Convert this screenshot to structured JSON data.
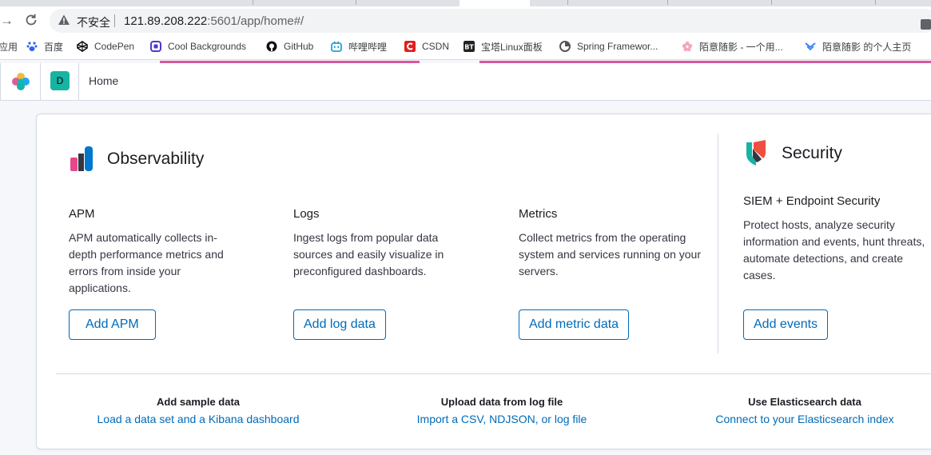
{
  "browser": {
    "security_label": "不安全",
    "url_host": "121.89.208.222",
    "url_rest": ":5601/app/home#/"
  },
  "bookmarks": [
    {
      "label": "应用",
      "icon": "apps-icon"
    },
    {
      "label": "百度",
      "icon": "baidu-icon"
    },
    {
      "label": "CodePen",
      "icon": "codepen-icon"
    },
    {
      "label": "Cool Backgrounds",
      "icon": "cool-backgrounds-icon"
    },
    {
      "label": "GitHub",
      "icon": "github-icon"
    },
    {
      "label": "哔哩哔哩",
      "icon": "bilibili-icon"
    },
    {
      "label": "CSDN",
      "icon": "csdn-icon"
    },
    {
      "label": "宝塔Linux面板",
      "icon": "bt-icon"
    },
    {
      "label": "Spring Framewor...",
      "icon": "spring-icon"
    },
    {
      "label": "陌意随影 - 一个用...",
      "icon": "flower-icon"
    },
    {
      "label": "陌意随影 的个人主页",
      "icon": "chevron-icon"
    }
  ],
  "kibana": {
    "space_initial": "D",
    "breadcrumb": "Home"
  },
  "observability": {
    "title": "Observability",
    "cards": [
      {
        "title": "APM",
        "description": "APM automatically collects in-depth performance metrics and errors from inside your applications.",
        "button": "Add APM"
      },
      {
        "title": "Logs",
        "description": "Ingest logs from popular data sources and easily visualize in preconfigured dashboards.",
        "button": "Add log data"
      },
      {
        "title": "Metrics",
        "description": "Collect metrics from the operating system and services running on your servers.",
        "button": "Add metric data"
      }
    ]
  },
  "security": {
    "title": "Security",
    "card": {
      "title": "SIEM + Endpoint Security",
      "description": "Protect hosts, analyze security information and events, hunt threats, automate detections, and create cases.",
      "button": "Add events"
    }
  },
  "footer": [
    {
      "title": "Add sample data",
      "link": "Load a data set and a Kibana dashboard"
    },
    {
      "title": "Upload data from log file",
      "link": "Import a CSV, NDJSON, or log file"
    },
    {
      "title": "Use Elasticsearch data",
      "link": "Connect to your Elasticsearch index"
    }
  ],
  "colors": {
    "accent": "#006bb8",
    "space_avatar": "#17b3a3",
    "bookmark_underline": "#d6589c"
  }
}
